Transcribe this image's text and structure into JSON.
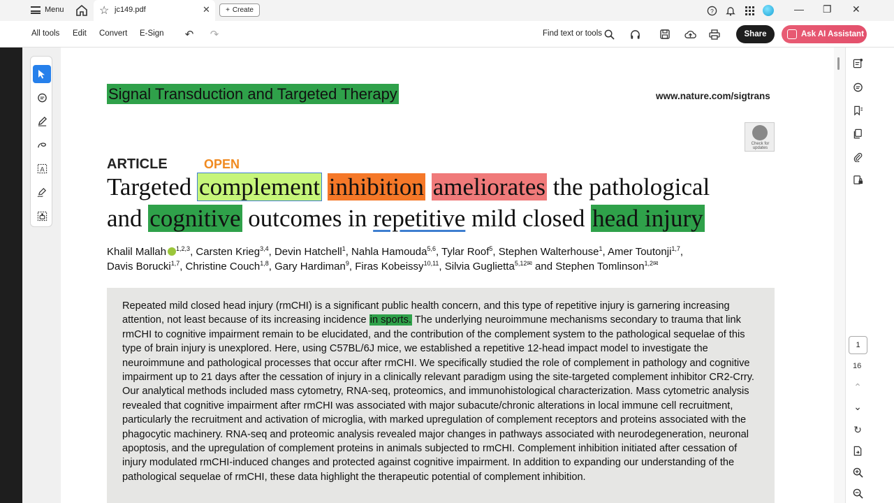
{
  "titlebar": {
    "menu_label": "Menu",
    "tab_label": "jc149.pdf",
    "create_label": "Create"
  },
  "toolbar": {
    "all_tools": "All tools",
    "edit": "Edit",
    "convert": "Convert",
    "esign": "E-Sign",
    "find_text": "Find text or tools",
    "share": "Share",
    "ask_ai": "Ask AI Assistant"
  },
  "doc": {
    "journal": "Signal Transduction and Targeted Therapy",
    "site": "www.nature.com/sigtrans",
    "check_updates": "Check for updates",
    "article": "ARTICLE",
    "open": "OPEN",
    "title": {
      "w1": "Targeted",
      "w2": "complement",
      "w3": "inhibition",
      "w4": "ameliorates",
      "w5": "the pathological",
      "w6": "and",
      "w7": "cognitive",
      "w8": "outcomes in",
      "w9": "repetitive",
      "w10": "mild closed",
      "w11": "head injury"
    },
    "authors_line1": [
      {
        "name": "Khalil Mallah",
        "sup": "1,2,3"
      },
      {
        "name": ", Carsten Krieg",
        "sup": "3,4"
      },
      {
        "name": ", Devin Hatchell",
        "sup": "1"
      },
      {
        "name": ", Nahla Hamouda",
        "sup": "5,6"
      },
      {
        "name": ", Tylar Roof",
        "sup": "5"
      },
      {
        "name": ", Stephen Walterhouse",
        "sup": "1"
      },
      {
        "name": ", Amer Toutonji",
        "sup": "1,7"
      },
      {
        "name": ",",
        "sup": ""
      }
    ],
    "authors_line2": [
      {
        "name": "Davis Borucki",
        "sup": "1,7"
      },
      {
        "name": ", Christine Couch",
        "sup": "1,8"
      },
      {
        "name": ", Gary Hardiman",
        "sup": "9"
      },
      {
        "name": ", Firas Kobeissy",
        "sup": "10,11"
      },
      {
        "name": ", Silvia Guglietta",
        "sup": "5,12✉"
      },
      {
        "name": " and Stephen Tomlinson",
        "sup": "1,2✉"
      }
    ],
    "abstract_before": "Repeated mild closed head injury (rmCHI) is a significant public health concern, and this type of repetitive injury is garnering increasing attention, not least because of its increasing incidence ",
    "abstract_highlight": "in sports.",
    "abstract_after": " The underlying neuroimmune mechanisms secondary to trauma that link rmCHI to cognitive impairment remain to be elucidated, and the contribution of the complement system to the pathological sequelae of this type of brain injury is unexplored. Here, using C57BL/6J mice, we established a repetitive 12-head impact model to investigate the neuroimmune and pathological processes that occur after rmCHI. We specifically studied the role of complement in pathology and cognitive impairment up to 21 days after the cessation of injury in a clinically relevant paradigm using the site-targeted complement inhibitor CR2-Crry. Our analytical methods included mass cytometry, RNA-seq, proteomics, and immunohistological characterization. Mass cytometric analysis revealed that cognitive impairment after rmCHI was associated with major subacute/chronic alterations in local immune cell recruitment, particularly the recruitment and activation of microglia, with marked upregulation of complement receptors and proteins associated with the phagocytic machinery. RNA-seq and proteomic analysis revealed major changes in pathways associated with neurodegeneration, neuronal apoptosis, and the upregulation of complement proteins in animals subjected to rmCHI. Complement inhibition initiated after cessation of injury modulated rmCHI-induced changes and protected against cognitive impairment. In addition to expanding our understanding of the pathological sequelae of rmCHI, these data highlight the therapeutic potential of complement inhibition."
  },
  "nav": {
    "current_page": "1",
    "total_pages": "16"
  },
  "colors": {
    "highlight_green": "#2fa14a",
    "highlight_lime": "#c6f57a",
    "highlight_orange": "#f57828",
    "highlight_pink": "#f07a7a",
    "accent_blue": "#2680eb",
    "ai_button": "#e3506c"
  }
}
